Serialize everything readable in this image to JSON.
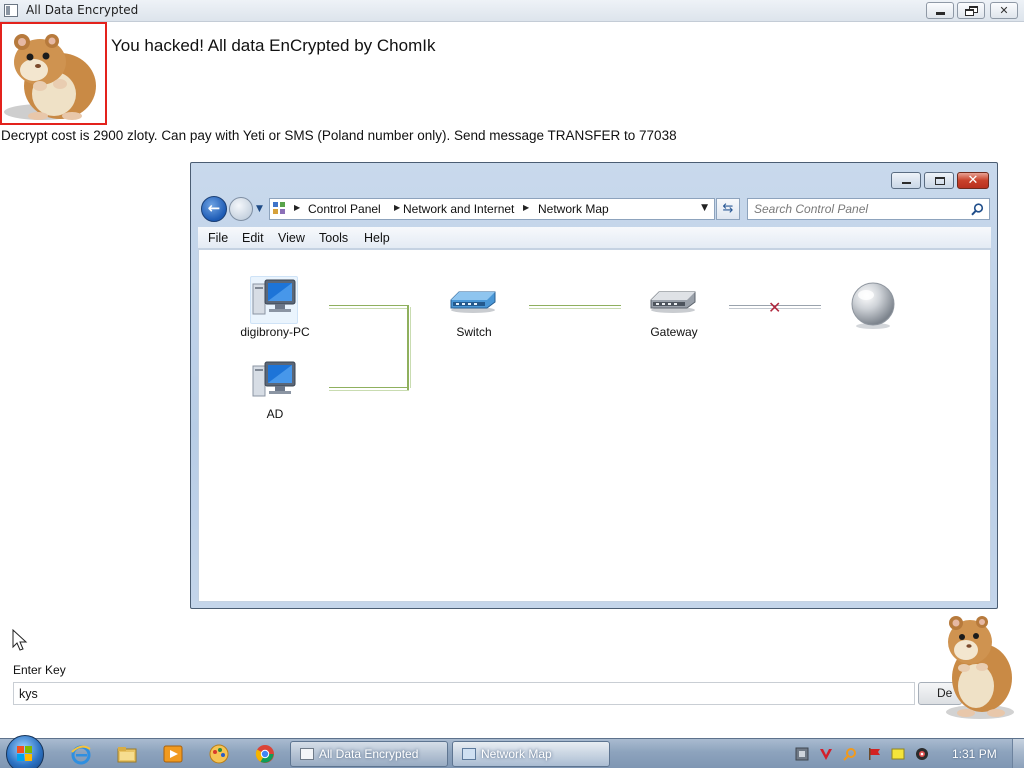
{
  "window": {
    "title": "All Data Encrypted"
  },
  "ransom": {
    "headline": "You hacked! All data EnCrypted by ChomIk",
    "note": "Decrypt cost is 2900 zloty. Can pay with Yeti or SMS (Poland number only). Send message TRANSFER to 77038"
  },
  "explorer": {
    "breadcrumbs": [
      "Control Panel",
      "Network and Internet",
      "Network Map"
    ],
    "search_placeholder": "Search Control Panel",
    "menu": [
      "File",
      "Edit",
      "View",
      "Tools",
      "Help"
    ],
    "nodes": {
      "pc1": "digibrony-PC",
      "pc2": "AD",
      "switch": "Switch",
      "gateway": "Gateway"
    }
  },
  "key_entry": {
    "label": "Enter Key",
    "value": "kys",
    "button_label": "De"
  },
  "taskbar": {
    "tasks": [
      {
        "label": "All Data Encrypted"
      },
      {
        "label": "Network Map"
      }
    ],
    "clock": "1:31 PM"
  },
  "colors": {
    "frame_red": "#e3221c",
    "link_green": "#9fbf76",
    "broken_link_x": "#b1283e"
  }
}
